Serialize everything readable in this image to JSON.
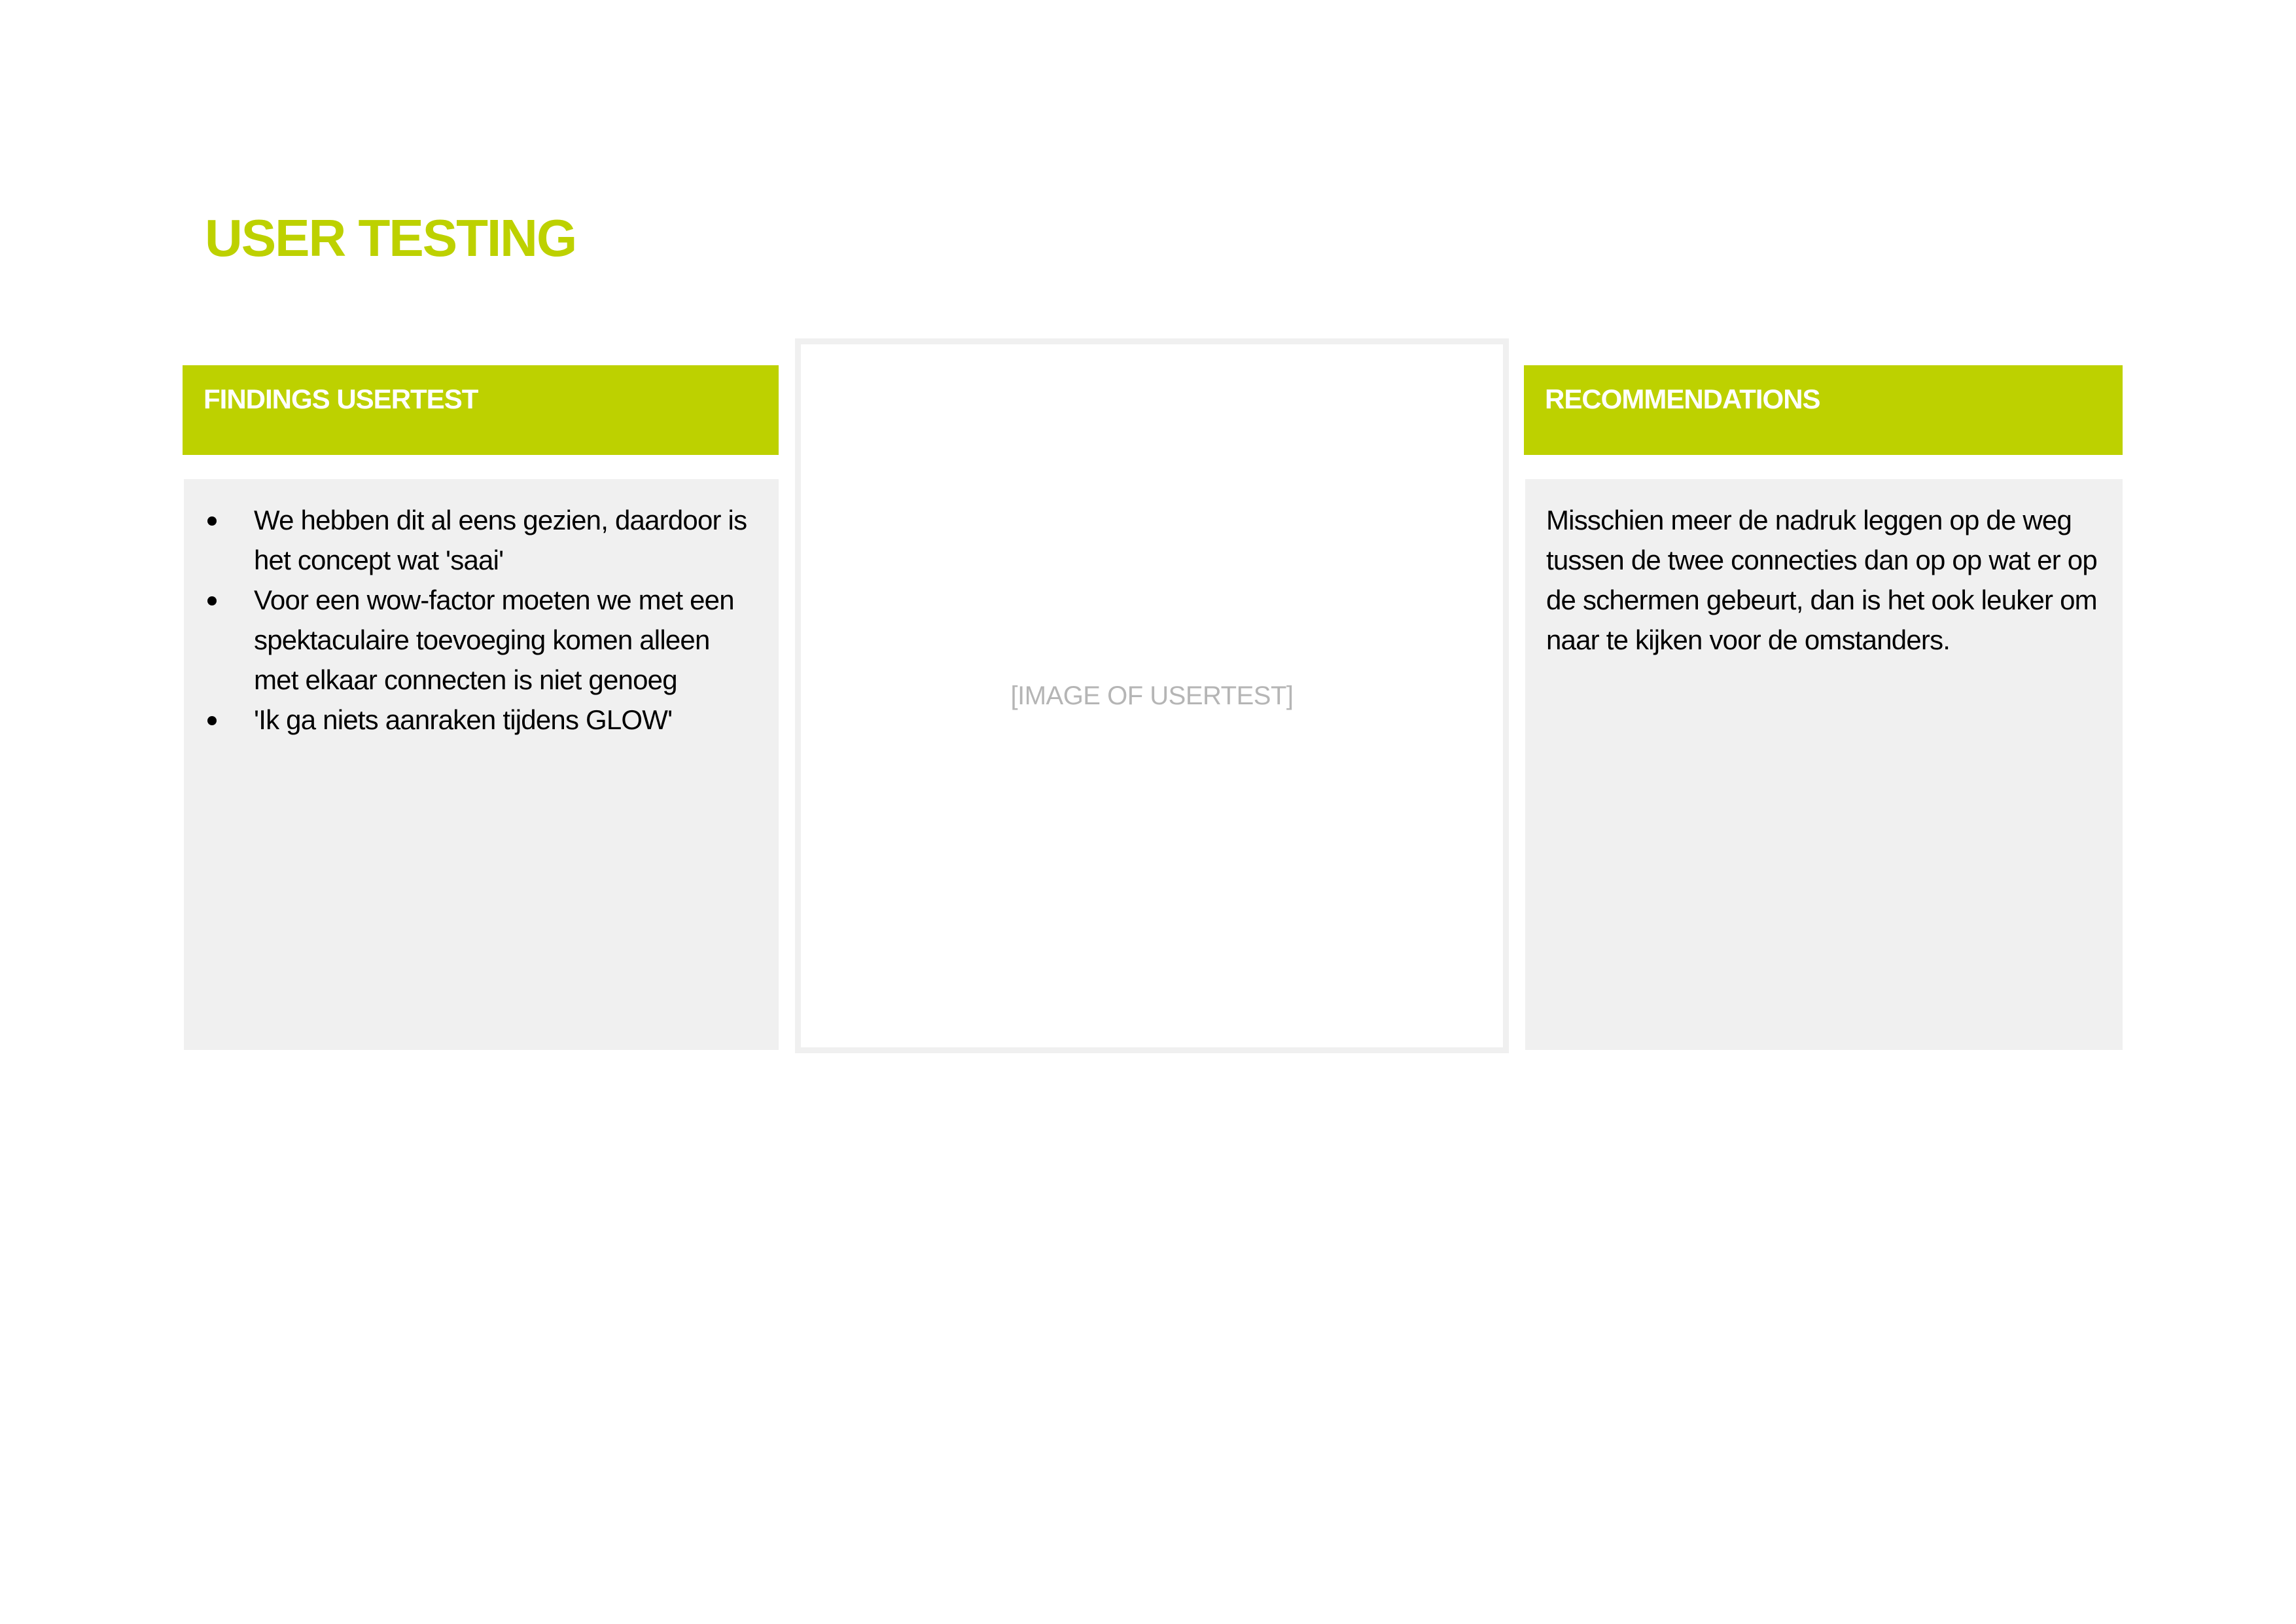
{
  "title": "USER TESTING",
  "findings": {
    "header": "FINDINGS USERTEST",
    "items": [
      "We hebben dit al eens gezien, daardoor is het concept wat 'saai'",
      "Voor een wow-factor moeten we met een spektaculaire toevoeging komen alleen met elkaar connecten is niet genoeg",
      "'Ik ga niets aanraken tijdens GLOW'"
    ]
  },
  "image_placeholder": "[IMAGE OF USERTEST]",
  "recommendations": {
    "header": "RECOMMENDATIONS",
    "text": "Misschien meer de nadruk leggen op de weg tussen de twee connecties dan op op wat er op de schermen gebeurt, dan is het ook leuker om naar te kijken voor de omstanders."
  },
  "colors": {
    "accent": "#bdd100",
    "panel": "#f0f0f0"
  }
}
